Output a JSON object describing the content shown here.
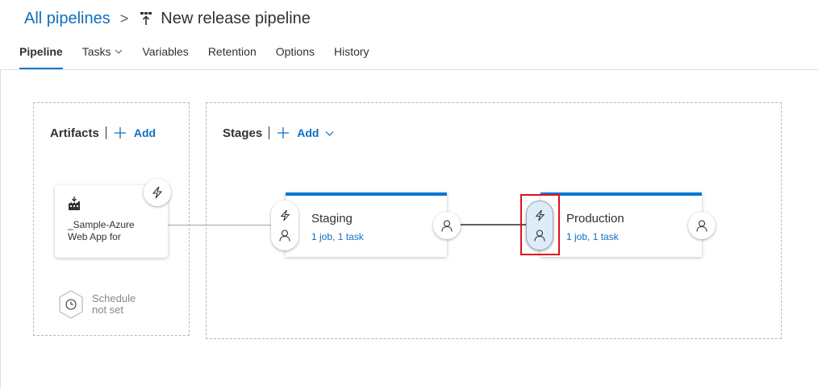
{
  "header": {
    "breadcrumb_root": "All pipelines",
    "separator": ">",
    "title": "New release pipeline",
    "title_icon": "release-pipeline-icon"
  },
  "tabs": [
    {
      "label": "Pipeline",
      "active": true
    },
    {
      "label": "Tasks",
      "has_dropdown": true
    },
    {
      "label": "Variables"
    },
    {
      "label": "Retention"
    },
    {
      "label": "Options"
    },
    {
      "label": "History"
    }
  ],
  "artifacts": {
    "title": "Artifacts",
    "add_label": "Add",
    "card": {
      "name": "_Sample-Azure Web App for",
      "icon": "build-artifact-icon"
    },
    "schedule": {
      "line1": "Schedule",
      "line2": "not set"
    }
  },
  "stages": {
    "title": "Stages",
    "add_label": "Add",
    "items": [
      {
        "name": "Staging",
        "summary": "1 job, 1 task"
      },
      {
        "name": "Production",
        "summary": "1 job, 1 task"
      }
    ]
  },
  "colors": {
    "accent": "#0078d4",
    "link": "#106ebe",
    "highlight": "#e0101e"
  }
}
